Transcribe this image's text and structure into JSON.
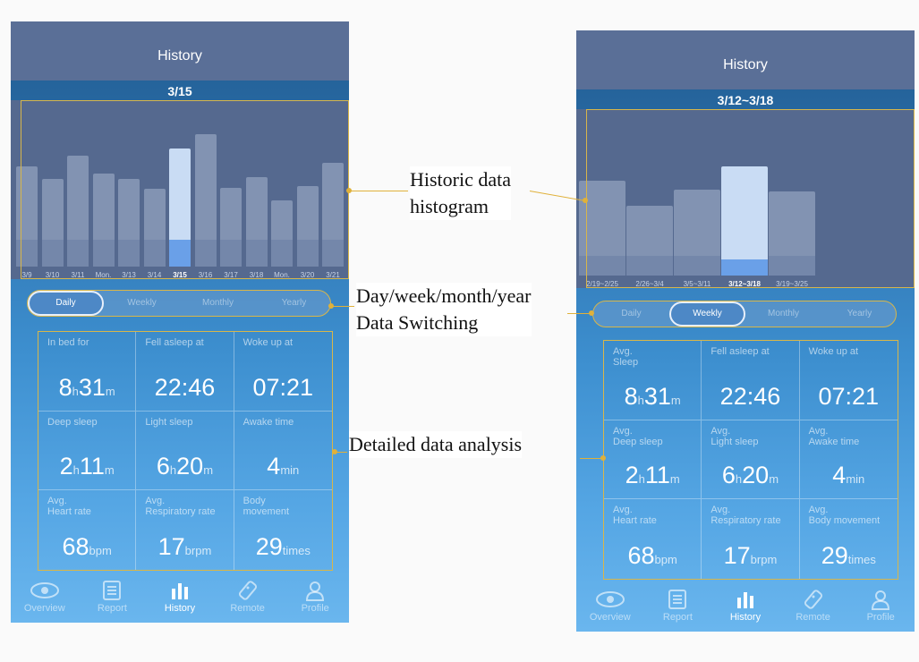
{
  "phone1": {
    "title": "History",
    "date": "3/15",
    "ticks": [
      "3/9",
      "3/10",
      "3/11",
      "Mon.",
      "3/13",
      "3/14",
      "3/15",
      "3/16",
      "3/17",
      "3/18",
      "Mon.",
      "3/20",
      "3/21"
    ],
    "selected_index": 6,
    "tabs": [
      "Daily",
      "Weekly",
      "Monthly",
      "Yearly"
    ],
    "active_tab": 0,
    "stats": [
      {
        "label": "In bed for",
        "v1": "8",
        "u1": "h",
        "v2": "31",
        "u2": "m"
      },
      {
        "label": "Fell asleep at",
        "v1": "22:46",
        "u1": "",
        "v2": "",
        "u2": ""
      },
      {
        "label": "Woke up at",
        "v1": "07:21",
        "u1": "",
        "v2": "",
        "u2": ""
      },
      {
        "label": "Deep sleep",
        "v1": "2",
        "u1": "h",
        "v2": "11",
        "u2": "m"
      },
      {
        "label": "Light sleep",
        "v1": "6",
        "u1": "h",
        "v2": "20",
        "u2": "m"
      },
      {
        "label": "Awake time",
        "v1": "4",
        "u1": "min",
        "v2": "",
        "u2": ""
      },
      {
        "label": "Avg.\nHeart rate",
        "v1": "68",
        "u1": "bpm",
        "v2": "",
        "u2": ""
      },
      {
        "label": "Avg.\nRespiratory rate",
        "v1": "17",
        "u1": "brpm",
        "v2": "",
        "u2": ""
      },
      {
        "label": "Body\nmovement",
        "v1": "29",
        "u1": "times",
        "v2": "",
        "u2": ""
      }
    ],
    "nav": [
      {
        "label": "Overview",
        "icon": "eye-icon"
      },
      {
        "label": "Report",
        "icon": "report-icon"
      },
      {
        "label": "History",
        "icon": "bar-chart-icon"
      },
      {
        "label": "Remote",
        "icon": "remote-icon"
      },
      {
        "label": "Profile",
        "icon": "person-icon"
      }
    ],
    "active_nav": 2
  },
  "phone2": {
    "title": "History",
    "date": "3/12~3/18",
    "ticks": [
      "2/19~2/25",
      "2/26~3/4",
      "3/5~3/11",
      "3/12~3/18",
      "3/19~3/25"
    ],
    "selected_index": 3,
    "tabs": [
      "Daily",
      "Weekly",
      "Monthly",
      "Yearly"
    ],
    "active_tab": 1,
    "stats": [
      {
        "label": "Avg.\nSleep",
        "v1": "8",
        "u1": "h",
        "v2": "31",
        "u2": "m"
      },
      {
        "label": "Fell asleep at",
        "v1": "22:46",
        "u1": "",
        "v2": "",
        "u2": ""
      },
      {
        "label": "Woke up at",
        "v1": "07:21",
        "u1": "",
        "v2": "",
        "u2": ""
      },
      {
        "label": "Avg.\nDeep sleep",
        "v1": "2",
        "u1": "h",
        "v2": "11",
        "u2": "m"
      },
      {
        "label": "Avg.\nLight sleep",
        "v1": "6",
        "u1": "h",
        "v2": "20",
        "u2": "m"
      },
      {
        "label": "Avg.\nAwake time",
        "v1": "4",
        "u1": "min",
        "v2": "",
        "u2": ""
      },
      {
        "label": "Avg.\nHeart rate",
        "v1": "68",
        "u1": "bpm",
        "v2": "",
        "u2": ""
      },
      {
        "label": "Avg.\nRespiratory rate",
        "v1": "17",
        "u1": "brpm",
        "v2": "",
        "u2": ""
      },
      {
        "label": "Avg.\nBody movement",
        "v1": "29",
        "u1": "times",
        "v2": "",
        "u2": ""
      }
    ],
    "nav": [
      {
        "label": "Overview",
        "icon": "eye-icon"
      },
      {
        "label": "Report",
        "icon": "report-icon"
      },
      {
        "label": "History",
        "icon": "bar-chart-icon"
      },
      {
        "label": "Remote",
        "icon": "remote-icon"
      },
      {
        "label": "Profile",
        "icon": "person-icon"
      }
    ],
    "active_nav": 2
  },
  "annotations": {
    "histogram_line1": "Historic data",
    "histogram_line2": "histogram",
    "switch_line1": "Day/week/month/year",
    "switch_line2": "Data Switching",
    "analysis": "Detailed data analysis"
  },
  "colors": {
    "accent_outline": "#d8b64a",
    "header": "#5a6f97",
    "selected_bar": "#c9dcf4",
    "selected_fill": "#6aa0e8"
  }
}
